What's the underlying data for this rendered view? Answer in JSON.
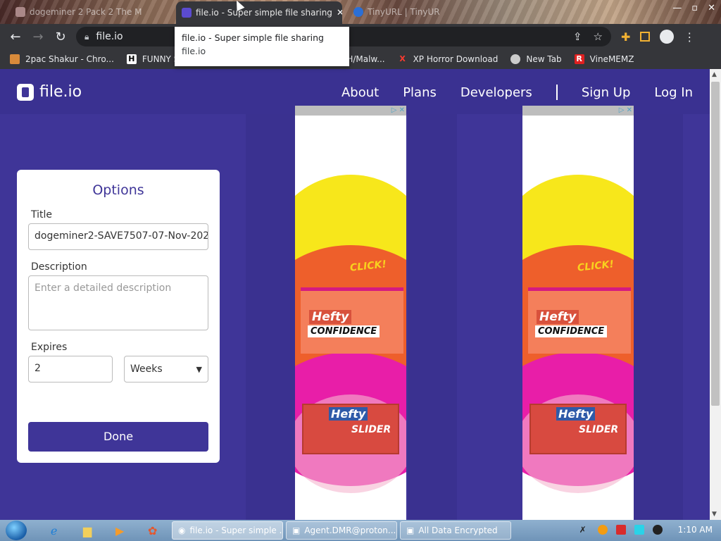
{
  "browser": {
    "tabs": [
      {
        "title": "dogeminer 2 Pack 2 The M",
        "active": false
      },
      {
        "title": "file.io - Super simple file sharing",
        "active": true
      },
      {
        "title": "TinyURL | TinyURL",
        "active": false
      }
    ],
    "window_controls": {
      "minimize": "—",
      "maximize": "▫",
      "close": "✕"
    },
    "address": "file.io",
    "bookmarks": [
      {
        "label": "2pac Shakur - Chro...",
        "icon": "bookmark-icon",
        "color": "#d88a3a",
        "glyph": "▤"
      },
      {
        "label": "FUNNY S",
        "icon": "h-icon",
        "color": "#ffffff",
        "glyph": "H"
      },
      {
        "label": "H/Malw...",
        "icon": "bookmark-icon",
        "color": "#888888",
        "glyph": ""
      },
      {
        "label": "XP Horror Download",
        "icon": "x-icon",
        "color": "#ff3b30",
        "glyph": "X"
      },
      {
        "label": "New Tab",
        "icon": "chrome-icon",
        "color": "#cccccc",
        "glyph": "◉"
      },
      {
        "label": "VineMEMZ",
        "icon": "r-icon",
        "color": "#e02020",
        "glyph": "R"
      }
    ],
    "tooltip": {
      "title": "file.io - Super simple file sharing",
      "url": "file.io"
    }
  },
  "site": {
    "logo_text": "file.io",
    "nav": [
      "About",
      "Plans",
      "Developers",
      "Sign Up",
      "Log In"
    ],
    "options": {
      "heading": "Options",
      "title_label": "Title",
      "title_value": "dogeminer2-SAVE7507-07-Nov-202",
      "description_label": "Description",
      "description_placeholder": "Enter a detailed description",
      "expires_label": "Expires",
      "expires_value": "2",
      "expires_unit": "Weeks",
      "done_label": "Done"
    },
    "ad": {
      "choices": "▷ ✕",
      "click_text": "CLICK!",
      "brand": "Hefty",
      "tagline": "CONFIDENCE",
      "product": "SLIDER"
    }
  },
  "taskbar": {
    "tasks": [
      {
        "label": "file.io - Super simple ...",
        "active": true
      },
      {
        "label": "Agent.DMR@proton...",
        "active": false
      },
      {
        "label": "All Data Encrypted",
        "active": false
      }
    ],
    "clock": "1:10 AM"
  },
  "colors": {
    "brand": "#3f3598",
    "accent_yellow": "#f7e71b",
    "accent_pink": "#e81ea8"
  }
}
